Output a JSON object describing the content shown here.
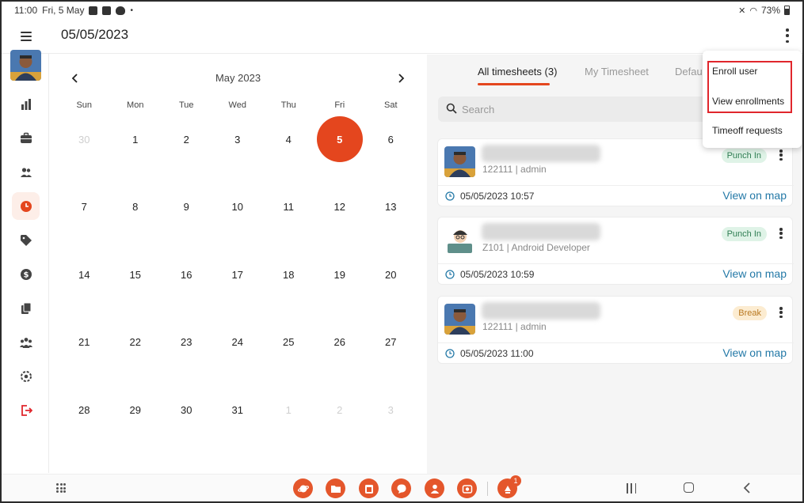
{
  "status_bar": {
    "time": "11:00",
    "date": "Fri, 5 May",
    "battery": "73%"
  },
  "header": {
    "title": "05/05/2023"
  },
  "calendar": {
    "month_label": "May 2023",
    "weekdays": [
      "Sun",
      "Mon",
      "Tue",
      "Wed",
      "Thu",
      "Fri",
      "Sat"
    ],
    "days": [
      {
        "label": "30",
        "muted": true
      },
      {
        "label": "1"
      },
      {
        "label": "2"
      },
      {
        "label": "3"
      },
      {
        "label": "4"
      },
      {
        "label": "5",
        "selected": true
      },
      {
        "label": "6"
      },
      {
        "label": "7"
      },
      {
        "label": "8"
      },
      {
        "label": "9"
      },
      {
        "label": "10"
      },
      {
        "label": "11"
      },
      {
        "label": "12"
      },
      {
        "label": "13"
      },
      {
        "label": "14"
      },
      {
        "label": "15"
      },
      {
        "label": "16"
      },
      {
        "label": "17"
      },
      {
        "label": "18"
      },
      {
        "label": "19"
      },
      {
        "label": "20"
      },
      {
        "label": "21"
      },
      {
        "label": "22"
      },
      {
        "label": "23"
      },
      {
        "label": "24"
      },
      {
        "label": "25"
      },
      {
        "label": "26"
      },
      {
        "label": "27"
      },
      {
        "label": "28"
      },
      {
        "label": "29"
      },
      {
        "label": "30"
      },
      {
        "label": "31"
      },
      {
        "label": "1",
        "muted": true
      },
      {
        "label": "2",
        "muted": true
      },
      {
        "label": "3",
        "muted": true
      }
    ]
  },
  "timesheets": {
    "tabs": [
      {
        "label": "All timesheets (3)",
        "active": true
      },
      {
        "label": "My Timesheet"
      },
      {
        "label": "Defau"
      }
    ],
    "search_placeholder": "Search",
    "cards": [
      {
        "subtitle": "122111 | admin",
        "status": "Punch In",
        "status_type": "punch",
        "avatar": "photo",
        "time": "05/05/2023 10:57",
        "link": "View on map"
      },
      {
        "subtitle": "Z101 | Android Developer",
        "status": "Punch In",
        "status_type": "punch",
        "avatar": "cartoon",
        "time": "05/05/2023 10:59",
        "link": "View on map"
      },
      {
        "subtitle": "122111 | admin",
        "status": "Break",
        "status_type": "break",
        "avatar": "photo",
        "time": "05/05/2023 11:00",
        "link": "View on map"
      }
    ]
  },
  "menu": {
    "items": [
      "Enroll user",
      "View enrollments",
      "Timeoff requests"
    ]
  },
  "dock": {
    "badge": "1"
  },
  "colors": {
    "accent": "#e4461e",
    "link": "#2479a7",
    "highlight": "#e0262c"
  }
}
